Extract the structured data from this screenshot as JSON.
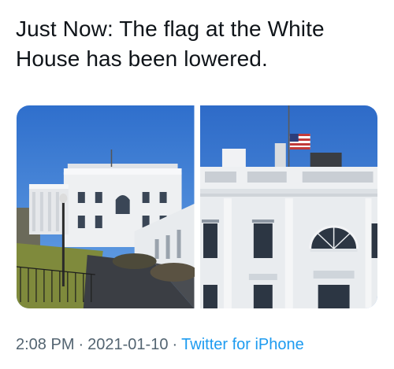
{
  "tweet": {
    "text": "Just Now: The flag at the White House has been lowered.",
    "media": [
      {
        "icon": "white-house-exterior-photo"
      },
      {
        "icon": "white-house-half-staff-flag-photo"
      }
    ]
  },
  "meta": {
    "time": "2:08 PM",
    "separator": "·",
    "date": "2021-01-10",
    "source": "Twitter for iPhone"
  },
  "colors": {
    "text": "#0f1419",
    "meta": "#536471",
    "link": "#1d9bf0",
    "sky": "#3f7ed3"
  }
}
